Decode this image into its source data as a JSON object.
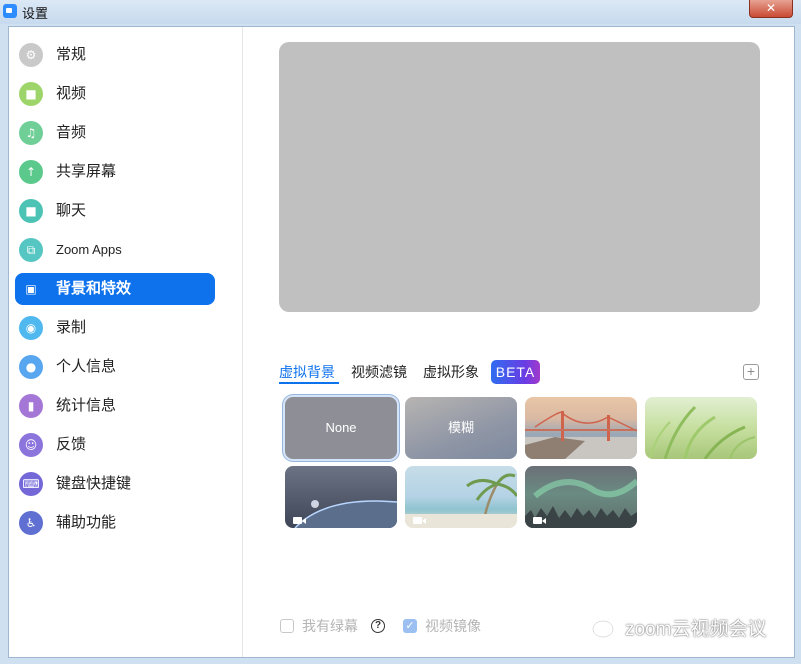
{
  "window": {
    "title": "设置",
    "close_label": "✕"
  },
  "sidebar": {
    "items": [
      {
        "label": "常规",
        "icon": "gear-icon",
        "glyph": "⚙",
        "color": "#c9c9c9",
        "active": false
      },
      {
        "label": "视频",
        "icon": "video-camera-icon",
        "glyph": "■",
        "color": "#9ed56b",
        "active": false
      },
      {
        "label": "音频",
        "icon": "headphones-icon",
        "glyph": "♫",
        "color": "#6fcf97",
        "active": false
      },
      {
        "label": "共享屏幕",
        "icon": "share-screen-icon",
        "glyph": "↑",
        "color": "#5bc98b",
        "active": false
      },
      {
        "label": "聊天",
        "icon": "chat-icon",
        "glyph": "■",
        "color": "#4cc3b5",
        "active": false
      },
      {
        "label": "Zoom Apps",
        "icon": "zoom-apps-icon",
        "glyph": "⧉",
        "color": "#55c6c2",
        "active": false
      },
      {
        "label": "背景和特效",
        "icon": "background-effects-icon",
        "glyph": "▣",
        "color": "#0e72ed",
        "active": true
      },
      {
        "label": "录制",
        "icon": "record-icon",
        "glyph": "◉",
        "color": "#4fb8ef",
        "active": false
      },
      {
        "label": "个人信息",
        "icon": "profile-icon",
        "glyph": "●",
        "color": "#58a6f0",
        "active": false
      },
      {
        "label": "统计信息",
        "icon": "statistics-icon",
        "glyph": "▮",
        "color": "#a477d6",
        "active": false
      },
      {
        "label": "反馈",
        "icon": "feedback-smiley-icon",
        "glyph": "☺",
        "color": "#8b74dc",
        "active": false
      },
      {
        "label": "键盘快捷键",
        "icon": "keyboard-icon",
        "glyph": "⌨",
        "color": "#7468d9",
        "active": false
      },
      {
        "label": "辅助功能",
        "icon": "accessibility-icon",
        "glyph": "♿",
        "color": "#5f6fd2",
        "active": false
      }
    ]
  },
  "tabs": [
    {
      "label": "虚拟背景",
      "active": true
    },
    {
      "label": "视频滤镜",
      "active": false
    },
    {
      "label": "虚拟形象",
      "active": false
    }
  ],
  "beta_badge": "BETA",
  "add_button": "+",
  "backgrounds": [
    {
      "label": "None",
      "name": "background-none",
      "selected": true,
      "video": false
    },
    {
      "label": "模糊",
      "name": "background-blur",
      "selected": false,
      "video": false
    },
    {
      "label": "",
      "name": "background-golden-gate-bridge",
      "selected": false,
      "video": false
    },
    {
      "label": "",
      "name": "background-grass",
      "selected": false,
      "video": false
    },
    {
      "label": "",
      "name": "background-earth-from-space",
      "selected": false,
      "video": true
    },
    {
      "label": "",
      "name": "background-beach-palm",
      "selected": false,
      "video": true
    },
    {
      "label": "",
      "name": "background-aurora",
      "selected": false,
      "video": true
    }
  ],
  "options": {
    "green_screen_label": "我有绿幕",
    "green_screen_checked": false,
    "help_glyph": "?",
    "mirror_label": "视频镜像",
    "mirror_checked": true,
    "check_glyph": "✓"
  },
  "watermark": {
    "text": "zoom云视频会议"
  },
  "colors": {
    "accent": "#0e72ed",
    "preview": "#c0c0c0"
  }
}
